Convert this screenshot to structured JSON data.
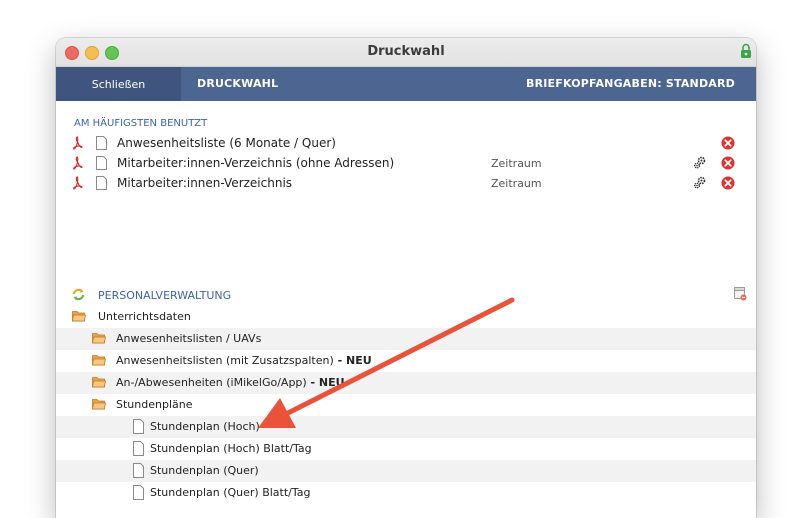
{
  "window": {
    "title": "Druckwahl"
  },
  "nav": {
    "close_label": "Schließen",
    "druckwahl_label": "DRUCKWAHL",
    "brief_label": "BRIEFKOPFANGABEN: STANDARD"
  },
  "favorites": {
    "section_label": "AM HÄUFIGSTEN BENUTZT",
    "items": [
      {
        "name": "Anwesenheitsliste (6 Monate / Quer)",
        "range": ""
      },
      {
        "name": "Mitarbeiter:innen-Verzeichnis (ohne Adressen)",
        "range": "Zeitraum"
      },
      {
        "name": "Mitarbeiter:innen-Verzeichnis",
        "range": "Zeitraum"
      }
    ]
  },
  "personal": {
    "label": "PERSONALVERWALTUNG"
  },
  "tree": {
    "root": "Unterrichtsdaten",
    "folders": [
      {
        "label": "Anwesenheitslisten / UAVs",
        "badge": ""
      },
      {
        "label": "Anwesenheitslisten (mit Zusatzspalten)",
        "badge": " - NEU"
      },
      {
        "label": "An-/Abwesenheiten (iMikelGo/App)",
        "badge": " - NEU"
      },
      {
        "label": "Stundenpläne",
        "badge": ""
      }
    ],
    "docs": [
      "Stundenplan (Hoch)",
      "Stundenplan (Hoch) Blatt/Tag",
      "Stundenplan (Quer)",
      "Stundenplan (Quer) Blatt/Tag"
    ]
  },
  "colors": {
    "nav_bg": "#4c6591",
    "nav_active": "#3f557d",
    "link_blue": "#3e63a8",
    "annotation_arrow": "#e8533a",
    "delete_red": "#e0302f"
  }
}
